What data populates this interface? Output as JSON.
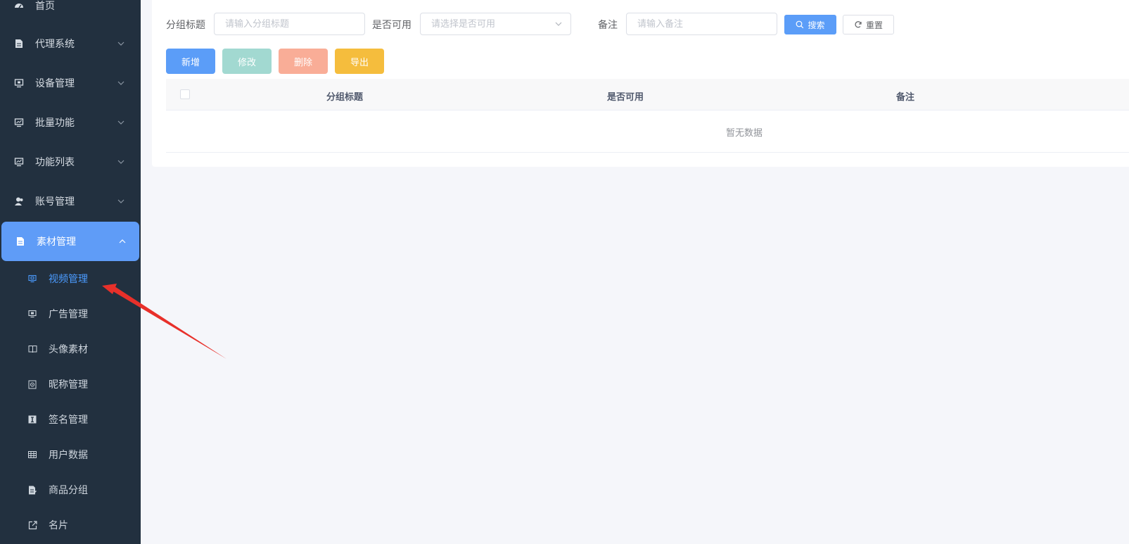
{
  "sidebar": {
    "top_item": {
      "label": "首页",
      "icon": "dashboard-icon"
    },
    "items": [
      {
        "label": "代理系统",
        "icon": "document-icon"
      },
      {
        "label": "设备管理",
        "icon": "monitor-icon"
      },
      {
        "label": "批量功能",
        "icon": "monitor-chart-icon"
      },
      {
        "label": "功能列表",
        "icon": "monitor-chart-icon"
      },
      {
        "label": "账号管理",
        "icon": "user-icon"
      },
      {
        "label": "素材管理",
        "icon": "document-icon",
        "expanded": true
      }
    ],
    "sub_items": [
      {
        "label": "视频管理",
        "icon": "monitor-icon",
        "selected": true
      },
      {
        "label": "广告管理",
        "icon": "monitor-icon"
      },
      {
        "label": "头像素材",
        "icon": "book-icon"
      },
      {
        "label": "昵称管理",
        "icon": "safe-icon"
      },
      {
        "label": "签名管理",
        "icon": "text-box-icon"
      },
      {
        "label": "用户数据",
        "icon": "table-icon"
      },
      {
        "label": "商品分组",
        "icon": "document-edit-icon"
      },
      {
        "label": "名片",
        "icon": "external-link-icon"
      }
    ]
  },
  "filters": {
    "group_title_label": "分组标题",
    "group_title_placeholder": "请输入分组标题",
    "available_label": "是否可用",
    "available_placeholder": "请选择是否可用",
    "remark_label": "备注",
    "remark_placeholder": "请输入备注",
    "search_button": "搜索",
    "reset_button": "重置"
  },
  "actions": {
    "add": "新增",
    "edit": "修改",
    "delete": "删除",
    "export": "导出"
  },
  "table": {
    "columns": [
      "分组标题",
      "是否可用",
      "备注"
    ],
    "empty_text": "暂无数据"
  },
  "colors": {
    "sidebar_bg": "#22303f",
    "primary": "#5b9df8",
    "selected_text": "#4b9bff",
    "annotation_arrow": "#e8302a"
  }
}
